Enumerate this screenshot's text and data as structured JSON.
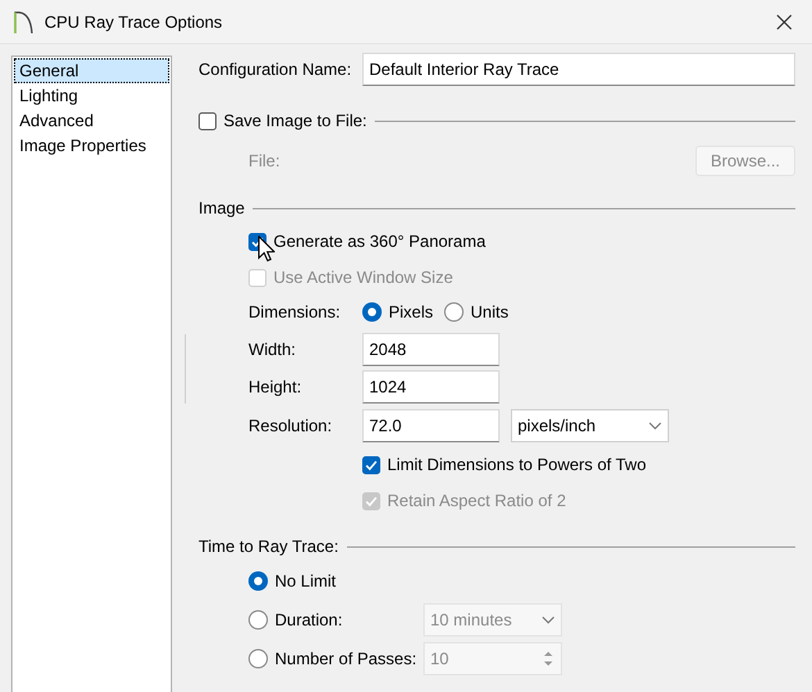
{
  "window": {
    "title": "CPU Ray Trace Options"
  },
  "sidebar": {
    "items": [
      {
        "label": "General",
        "selected": true
      },
      {
        "label": "Lighting",
        "selected": false
      },
      {
        "label": "Advanced",
        "selected": false
      },
      {
        "label": "Image Properties",
        "selected": false
      }
    ]
  },
  "configuration_name": {
    "label": "Configuration Name:",
    "value": "Default Interior Ray Trace"
  },
  "save_image": {
    "label": "Save Image to File:",
    "checked": false
  },
  "file": {
    "label": "File:",
    "disabled": true,
    "browse_button": "Browse..."
  },
  "image": {
    "title": "Image",
    "options": [
      {
        "label": "Generate as 360° Panorama",
        "checked": true,
        "disabled": false
      },
      {
        "label": "Use Active Window Size",
        "checked": false,
        "disabled": true
      }
    ],
    "dimensions": {
      "label": "Dimensions:",
      "options": [
        {
          "label": "Pixels",
          "selected": true
        },
        {
          "label": "Units",
          "selected": false
        }
      ]
    },
    "width": {
      "label": "Width:",
      "value": "2048"
    },
    "height": {
      "label": "Height:",
      "value": "1024"
    },
    "resolution": {
      "label": "Resolution:",
      "value": "72.0",
      "unit": "pixels/inch"
    },
    "limit_options": [
      {
        "label": "Limit Dimensions to Powers of Two",
        "checked": true,
        "disabled": false
      },
      {
        "label": "Retain Aspect Ratio of 2",
        "checked": true,
        "disabled": true
      }
    ]
  },
  "time_to_ray_trace": {
    "title": "Time to Ray Trace:",
    "options": [
      {
        "kind": "plain",
        "label": "No Limit",
        "selected": true
      },
      {
        "kind": "dropdown",
        "label": "Duration:",
        "selected": false,
        "value": "10 minutes",
        "disabled": true
      },
      {
        "kind": "spinner",
        "label": "Number of Passes:",
        "selected": false,
        "value": "10",
        "disabled": true
      }
    ]
  }
}
